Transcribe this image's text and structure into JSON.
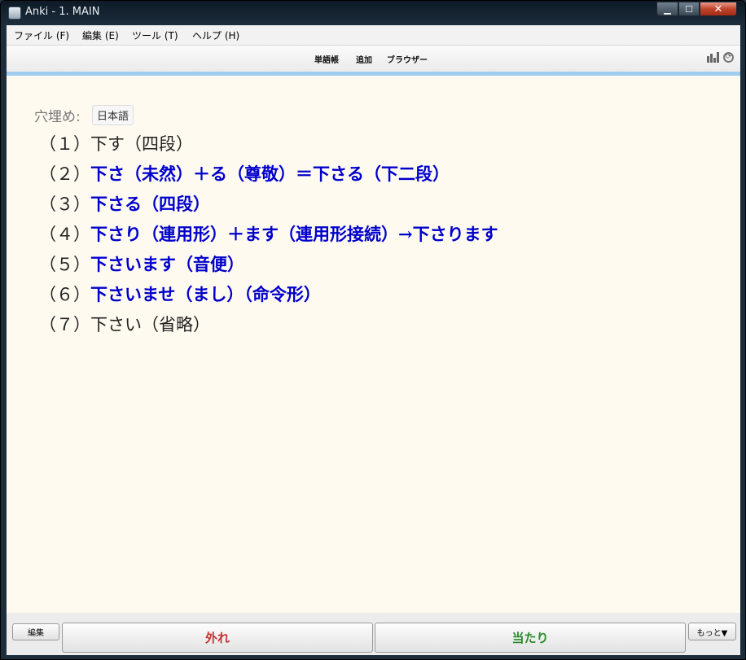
{
  "window": {
    "title": "Anki - 1. MAIN"
  },
  "menu": [
    "ファイル (F)",
    "編集 (E)",
    "ツール (T)",
    "ヘルプ (H)"
  ],
  "toolbar": {
    "links": [
      "単語帳",
      "追加",
      "ブラウザー"
    ]
  },
  "card": {
    "label": "穴埋め:",
    "tag": "日本語",
    "lines": [
      {
        "num": "（１）",
        "text": "下す（四段）",
        "highlight": false
      },
      {
        "num": "（２）",
        "text": "下さ（未然）＋る（尊敬）＝下さる（下二段）",
        "highlight": true
      },
      {
        "num": "（３）",
        "text": "下さる（四段）",
        "highlight": true
      },
      {
        "num": "（４）",
        "text": "下さり（連用形）＋ます（連用形接続）→下さります",
        "highlight": true
      },
      {
        "num": "（５）",
        "text": "下さいます（音便）",
        "highlight": true
      },
      {
        "num": "（６）",
        "text": "下さいませ（まし）（命令形）",
        "highlight": true
      },
      {
        "num": "（７）",
        "text": "下さい（省略）",
        "highlight": false
      }
    ]
  },
  "bottom": {
    "edit": "編集",
    "again": "外れ",
    "good": "当たり",
    "more": "もっと▼",
    "again_color": "#c33333",
    "good_color": "#2a8a2a"
  }
}
